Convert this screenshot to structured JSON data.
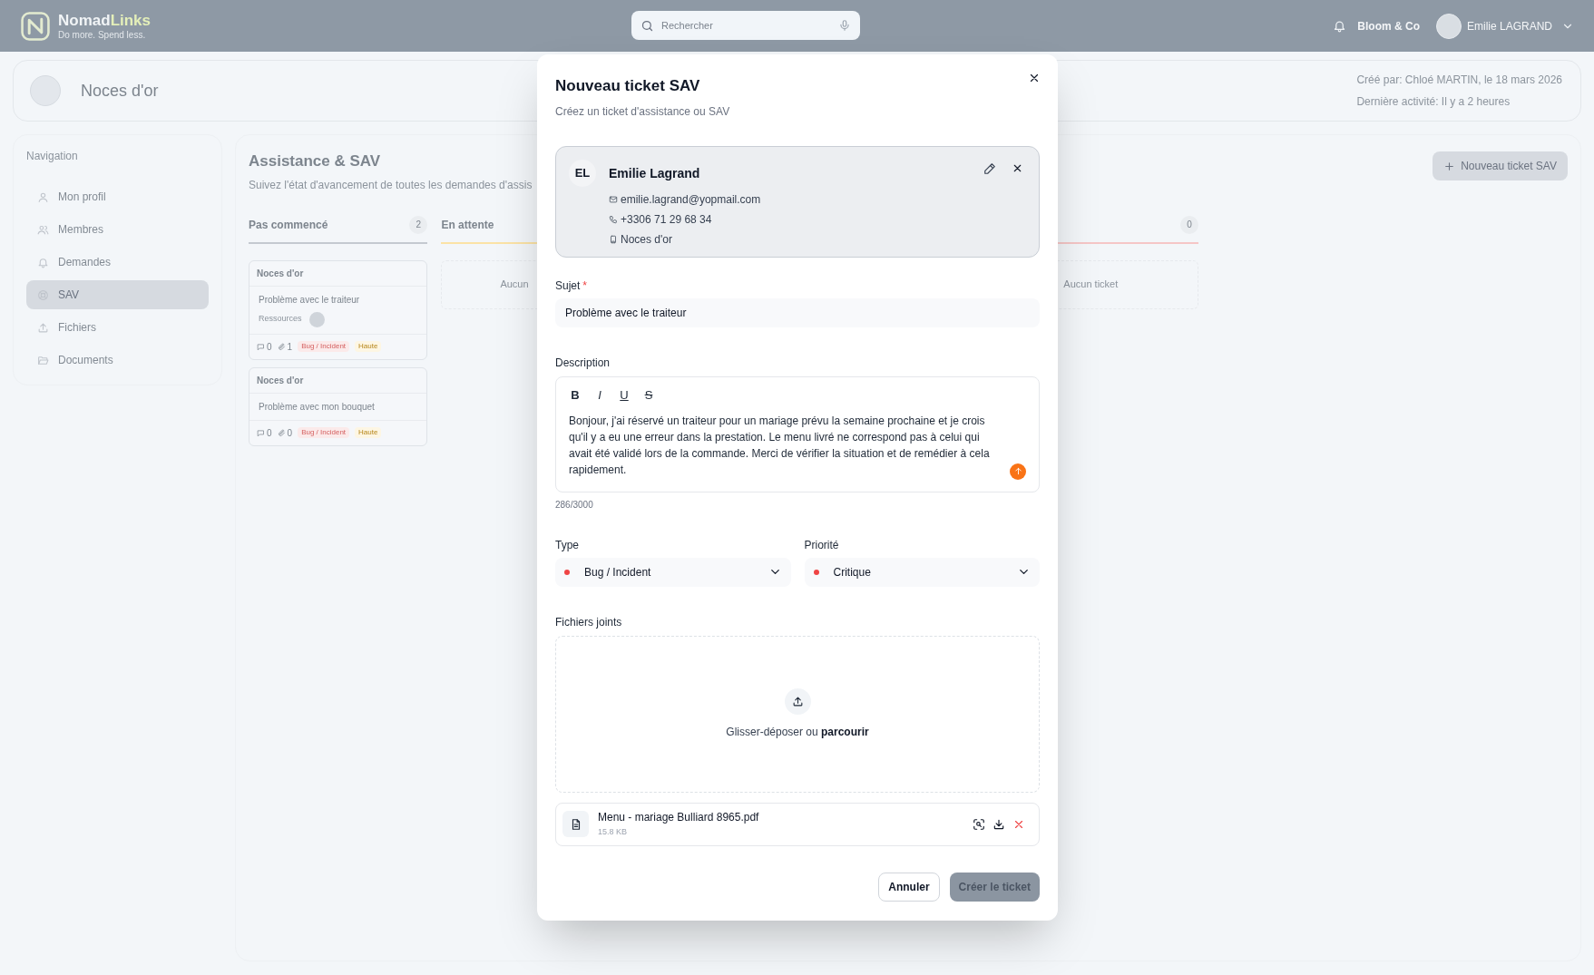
{
  "header": {
    "logo": {
      "name": "Nomad",
      "name_accent": "Links",
      "tagline": "Do more. Spend less."
    },
    "search": {
      "placeholder": "Rechercher"
    },
    "company": "Bloom & Co",
    "user": "Emilie LAGRAND"
  },
  "page_header": {
    "title": "Noces d'or",
    "created": "Créé par: Chloé MARTIN, le 18 mars 2026",
    "last_activity": "Dernière activité: Il y a 2 heures"
  },
  "navigation": {
    "title": "Navigation",
    "items": [
      {
        "label": "Mon profil",
        "kind": "profile",
        "selected": false
      },
      {
        "label": "Membres",
        "kind": "members",
        "selected": false
      },
      {
        "label": "Demandes",
        "kind": "requests",
        "selected": false
      },
      {
        "label": "SAV",
        "kind": "support",
        "selected": true
      },
      {
        "label": "Fichiers",
        "kind": "files",
        "selected": false
      },
      {
        "label": "Documents",
        "kind": "documents",
        "selected": false
      }
    ]
  },
  "board": {
    "title": "Assistance & SAV",
    "subtitle": "Suivez l'état d'avancement de toutes les demandes d'assis",
    "new_button": "Nouveau ticket SAV",
    "columns": [
      {
        "title": "Pas commencé",
        "count": "2",
        "color": "#c4c9d0",
        "tickets": [
          {
            "project": "Noces d'or",
            "title": "Problème avec le traiteur",
            "resources_label": "Ressources",
            "comments": "0",
            "attachments": "1",
            "type_tag": "Bug / Incident",
            "priority_tag": "Haute"
          },
          {
            "project": "Noces d'or",
            "title": "Problème avec mon bouquet",
            "comments": "0",
            "attachments": "0",
            "type_tag": "Bug / Incident",
            "priority_tag": "Haute"
          }
        ]
      },
      {
        "title": "En attente",
        "color": "#fbe3a6",
        "empty": "Aucun"
      },
      {
        "count": "0",
        "color": "#f5c6c6",
        "empty": "Aucun ticket"
      }
    ]
  },
  "modal": {
    "title": "Nouveau ticket SAV",
    "subtitle": "Créez un ticket d'assistance ou SAV",
    "contact": {
      "initials": "EL",
      "name": "Emilie Lagrand",
      "email": "emilie.lagrand@yopmail.com",
      "phone": "+3306 71 29 68 34",
      "project": "Noces d'or"
    },
    "subject": {
      "label": "Sujet",
      "required_mark": "*",
      "value": "Problème avec le traiteur"
    },
    "description": {
      "label": "Description",
      "toolbar": [
        {
          "glyph": "B",
          "kind": "bold"
        },
        {
          "glyph": "I",
          "kind": "italic"
        },
        {
          "glyph": "U",
          "kind": "underline"
        },
        {
          "glyph": "S",
          "kind": "strike"
        }
      ],
      "text": "Bonjour, j'ai réservé un traiteur pour un mariage prévu la semaine prochaine et je crois qu'il y a eu une erreur dans la prestation. Le menu livré ne correspond pas à celui qui avait été validé lors de la commande. Merci de vérifier la situation et de remédier à cela rapidement.",
      "counter": "286/3000"
    },
    "type": {
      "label": "Type",
      "value": "Bug / Incident",
      "color": "#ef4444"
    },
    "priority": {
      "label": "Priorité",
      "value": "Critique",
      "color": "#ef4444"
    },
    "attachments": {
      "label": "Fichiers joints",
      "drop_text": "Glisser-déposer ou **parcourir**",
      "files": [
        {
          "name": "Menu - mariage Bulliard 8965.pdf",
          "size": "15.8 KB"
        }
      ]
    },
    "buttons": {
      "cancel": "Annuler",
      "submit": "Créer le ticket",
      "submit_disabled": true
    }
  }
}
